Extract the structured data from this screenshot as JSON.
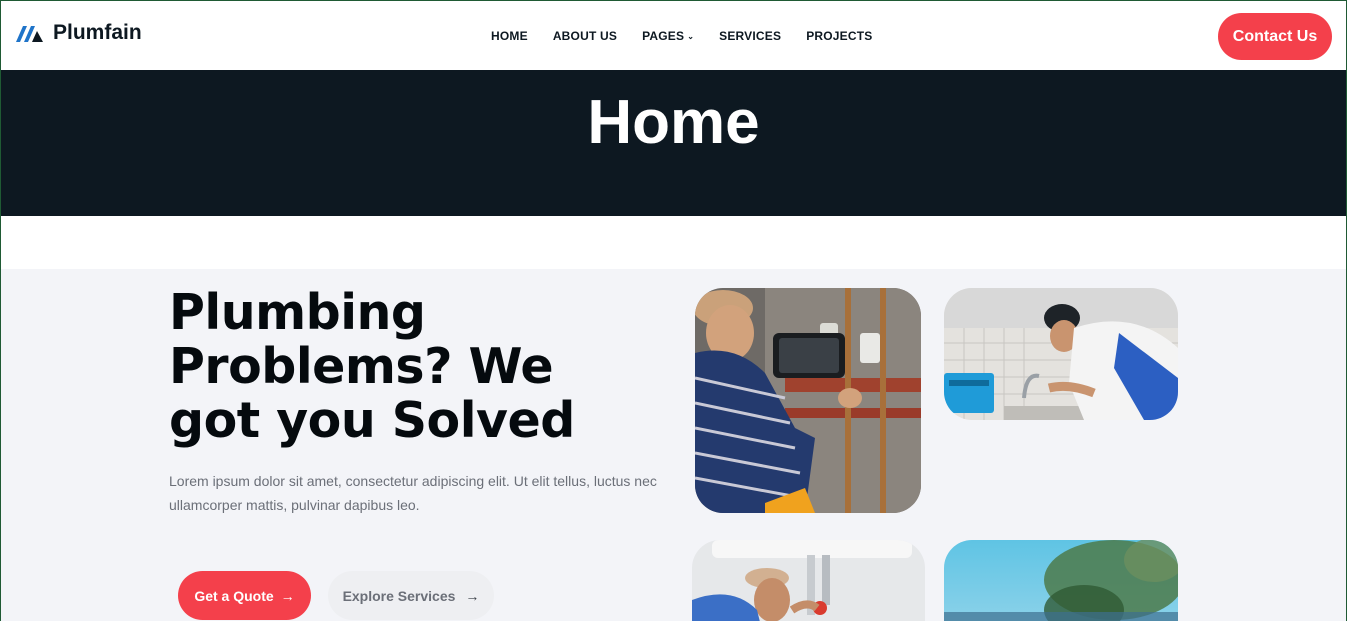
{
  "brand": {
    "name": "Plumfain",
    "accent": "#f4404b",
    "dark": "#0d1821",
    "logo_blue": "#1f74c9"
  },
  "nav": {
    "items": [
      {
        "label": "HOME"
      },
      {
        "label": "ABOUT US"
      },
      {
        "label": "PAGES",
        "has_dropdown": true
      },
      {
        "label": "SERVICES"
      },
      {
        "label": "PROJECTS"
      }
    ],
    "dropdown_icon": "chevron-down-icon"
  },
  "header": {
    "contact_label": "Contact Us"
  },
  "banner": {
    "title": "Home"
  },
  "hero": {
    "title": "Plumbing Problems? We got you Solved",
    "description": "Lorem ipsum dolor sit amet, consectetur adipiscing elit. Ut elit tellus, luctus nec ullamcorper mattis, pulvinar dapibus leo.",
    "primary_button": "Get a Quote",
    "secondary_button": "Explore Services",
    "arrow_icon": "arrow-right-icon"
  },
  "gallery": {
    "images": [
      {
        "name": "plumber-with-tablet-photo"
      },
      {
        "name": "plumber-kitchen-sink-photo"
      },
      {
        "name": "plumber-under-sink-photo"
      },
      {
        "name": "outdoor-blur-photo"
      }
    ]
  }
}
